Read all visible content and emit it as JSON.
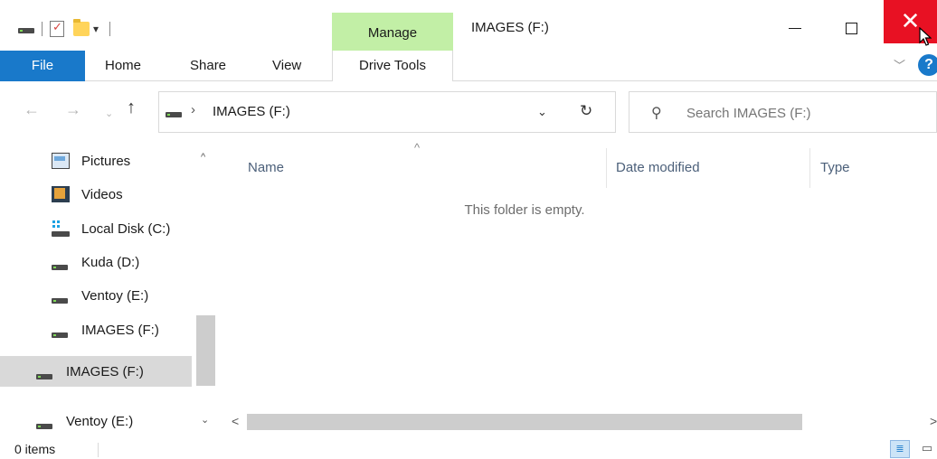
{
  "titlebar": {
    "window_title": "IMAGES (F:)",
    "context_group_label": "Manage",
    "qat_dropdown_glyph": "▾",
    "close_glyph": "✕"
  },
  "ribbon": {
    "tabs": {
      "file": "File",
      "home": "Home",
      "share": "Share",
      "view": "View",
      "drive_tools": "Drive Tools"
    },
    "help_glyph": "?",
    "chevron_glyph": "﹀"
  },
  "navigation": {
    "back_glyph": "←",
    "forward_glyph": "→",
    "recent_glyph": "⌄",
    "up_glyph": "↑",
    "address_separator": "›",
    "address_path": "IMAGES (F:)",
    "address_dropdown_glyph": "⌄",
    "refresh_glyph": "↻",
    "search_icon_glyph": "⚲",
    "search_placeholder": "Search IMAGES (F:)"
  },
  "nav_pane": {
    "items": [
      {
        "label": "Pictures",
        "icon": "pictures-icon"
      },
      {
        "label": "Videos",
        "icon": "videos-icon"
      },
      {
        "label": "Local Disk (C:)",
        "icon": "local-disk-icon"
      },
      {
        "label": "Kuda (D:)",
        "icon": "drive-icon"
      },
      {
        "label": "Ventoy (E:)",
        "icon": "drive-icon"
      },
      {
        "label": "IMAGES (F:)",
        "icon": "drive-icon"
      },
      {
        "label": "IMAGES (F:)",
        "icon": "drive-icon",
        "selected": true
      },
      {
        "label": "Ventoy (E:)",
        "icon": "drive-icon"
      }
    ],
    "scroll_up_glyph": "^",
    "scroll_down_glyph": "⌄"
  },
  "content": {
    "columns": [
      "Name",
      "Date modified",
      "Type"
    ],
    "sort_glyph": "^",
    "empty_message": "This folder is empty.",
    "hscroll_left_glyph": "<",
    "hscroll_right_glyph": ">"
  },
  "statusbar": {
    "item_count": "0 items"
  },
  "colors": {
    "accent": "#1979ca",
    "context_tab": "#c2efa6",
    "close_hover": "#e81123",
    "selection": "#d9d9d9"
  }
}
